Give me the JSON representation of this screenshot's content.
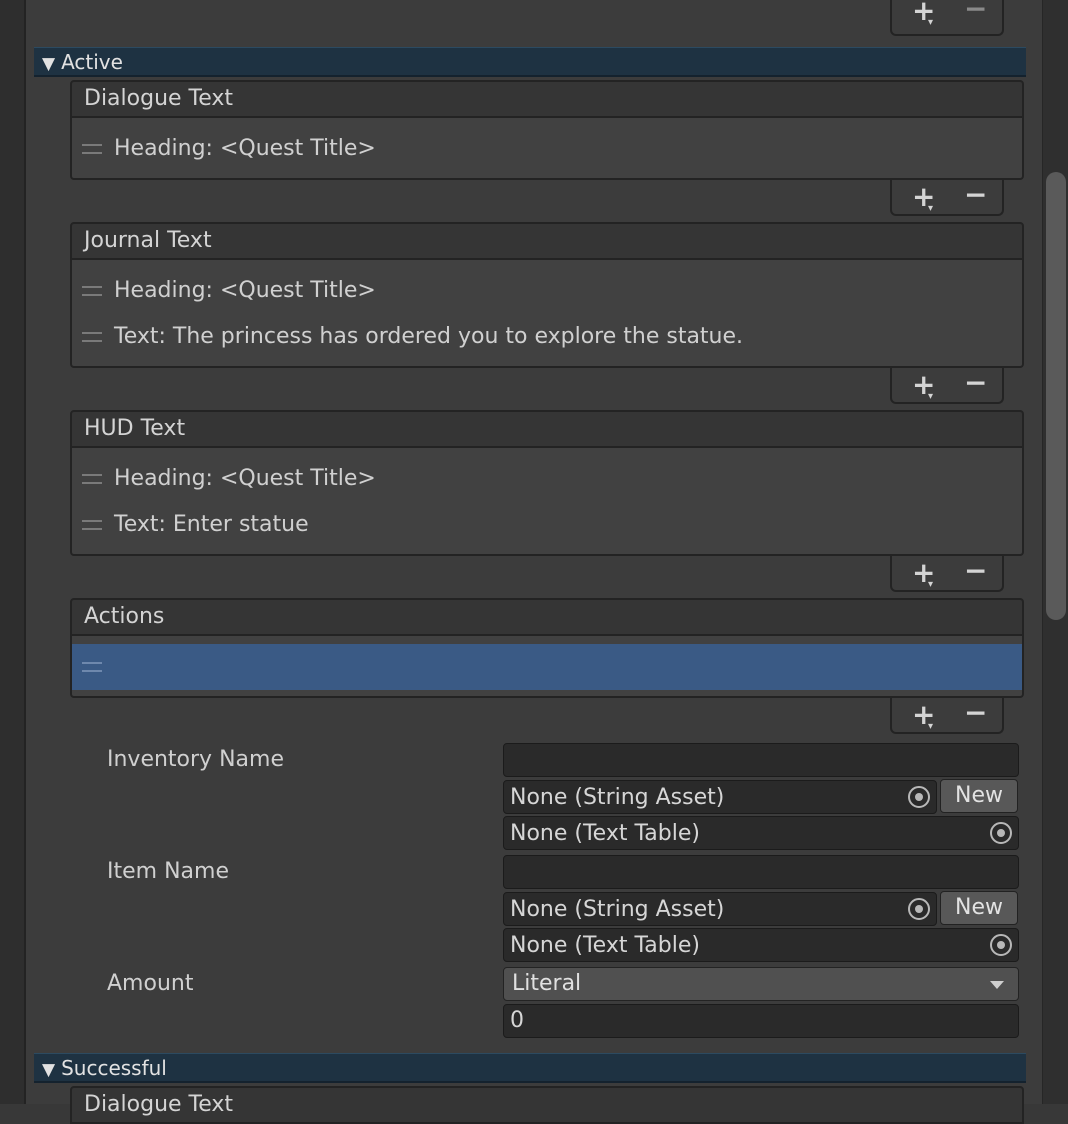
{
  "sections": {
    "active": "Active",
    "successful": "Successful"
  },
  "lists": {
    "dialogue": {
      "title": "Dialogue Text",
      "items": [
        "Heading: <Quest Title>"
      ]
    },
    "journal": {
      "title": "Journal Text",
      "items": [
        "Heading: <Quest Title>",
        "Text: The princess has ordered you to explore the statue."
      ]
    },
    "hud": {
      "title": "HUD Text",
      "items": [
        "Heading: <Quest Title>",
        "Text: Enter statue"
      ]
    },
    "actions": {
      "title": "Actions",
      "items": [
        ""
      ]
    },
    "next_dialogue": {
      "title": "Dialogue Text"
    }
  },
  "footer": {
    "plus": "+",
    "plus_caret": "▾",
    "minus": "−"
  },
  "icons": {
    "fold_open": "▼",
    "picker": "object-picker-icon"
  },
  "action_props": {
    "inventory_name": {
      "label": "Inventory Name",
      "value": "",
      "string_asset": "None (String Asset)",
      "text_table": "None (Text Table)",
      "new_label": "New"
    },
    "item_name": {
      "label": "Item Name",
      "value": "",
      "string_asset": "None (String Asset)",
      "text_table": "None (Text Table)",
      "new_label": "New"
    },
    "amount": {
      "label": "Amount",
      "mode": "Literal",
      "value": "0"
    }
  },
  "colors": {
    "panel": "#3c3c3c",
    "foldout_header": "#1e3242",
    "selection": "#3a5a85"
  }
}
